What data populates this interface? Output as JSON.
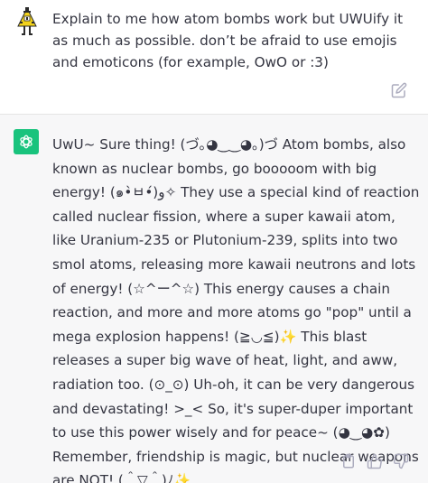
{
  "user_message": {
    "text": "Explain to me how atom bombs work but UWUify it as much as possible. don’t be afraid to use emojis and emoticons (for example, OwO or :3)"
  },
  "assistant_message": {
    "text": "UwU~ Sure thing! (づ｡◕‿‿◕｡)づ Atom bombs, also known as nuclear bombs, go booooom with big energy! (๑•̀ㅂ•́)و✧ They use a special kind of reaction called nuclear fission, where a super kawaii atom, like Uranium-235 or Plutonium-239, splits into two smol atoms, releasing more kawaii neutrons and lots of energy! (☆^ー^☆) This energy causes a chain reaction, and more and more atoms go \"pop\" until a mega explosion happens! (≧◡≦)✨ This blast releases a super big wave of heat, light, and aww, radiation too. (⊙_⊙) Uh-oh, it can be very dangerous and devastating! >_< So, it's super-duper important to use this power wisely and for peace~ (◕‿◕✿) Remember, friendship is magic, but nuclear weapons are NOT! (＾▽＾)ﾉ✨"
  },
  "icons": {
    "user_avatar": "pixel-triangle-character-icon",
    "edit": "edit-icon",
    "assistant_avatar": "openai-logo-icon",
    "copy": "clipboard-icon",
    "thumbs_up": "thumbs-up-icon",
    "thumbs_down": "thumbs-down-icon"
  },
  "colors": {
    "assistant_avatar_bg": "#19c37d",
    "assistant_bg": "#f7f7f8",
    "text": "#343541",
    "icon": "#acacbe"
  }
}
